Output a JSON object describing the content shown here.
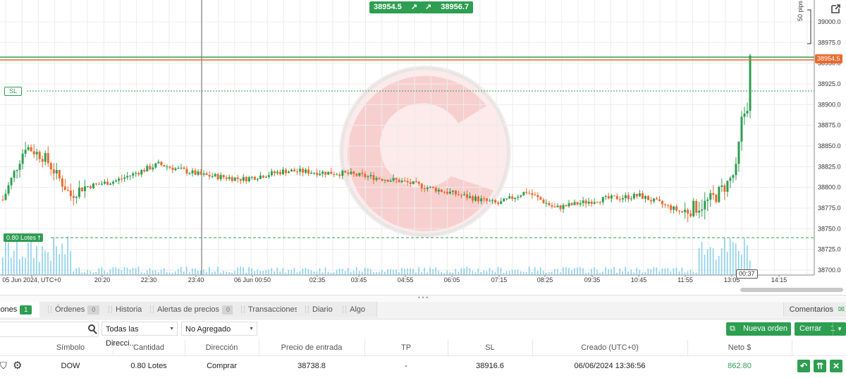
{
  "chart": {
    "sell_price": "38954.5",
    "buy_price": "38956.7",
    "pips_label": "50 pips",
    "sl_label": "SL",
    "lots_label": "0.80 Lotes",
    "current_price_tag": "38954.5",
    "timer": "00:37",
    "y_ticks": [
      "39000.0",
      "38975.0",
      "38950.0",
      "38925.0",
      "38900.0",
      "38875.0",
      "38850.0",
      "38825.0",
      "38800.0",
      "38775.0",
      "38750.0",
      "38725.0",
      "38700.0"
    ],
    "x_ticks": [
      "05 Jun 2024, UTC+0",
      "20:20",
      "22:30",
      "23:40",
      "06 Jun 00:50",
      "02:35",
      "03:45",
      "04:55",
      "06:05",
      "07:15",
      "08:25",
      "09:35",
      "10:45",
      "11:55",
      "13:05",
      "14:15"
    ],
    "colors": {
      "up": "#2e9e51",
      "down": "#ea6a2e",
      "volume": "#6ec6e8",
      "grid": "#ececec"
    }
  },
  "tabs": [
    {
      "label": "iones",
      "count": "1"
    },
    {
      "label": "Órdenes",
      "count": "0"
    },
    {
      "label": "Historial",
      "count": ""
    },
    {
      "label": "Alertas de precios",
      "count": "0"
    },
    {
      "label": "Transacciones",
      "count": ""
    },
    {
      "label": "Diario",
      "count": ""
    },
    {
      "label": "Algo",
      "count": ""
    }
  ],
  "comments_label": "Comentarios",
  "toolbar": {
    "direction_select": "Todas las Direcci...",
    "aggregate_select": "No Agregado",
    "new_order": "Nueva orden",
    "close_label": "Cerrar",
    "close_count": "1"
  },
  "table": {
    "headers": [
      "Símbolo",
      "Cantidad",
      "Dirección",
      "Precio de entrada",
      "TP",
      "SL",
      "Creado (UTC+0)",
      "Neto $"
    ],
    "row": [
      "DOW",
      "0.80 Lotes",
      "Comprar",
      "38738.8",
      "-",
      "38916.6",
      "06/06/2024 13:36:56",
      "862.80"
    ]
  }
}
